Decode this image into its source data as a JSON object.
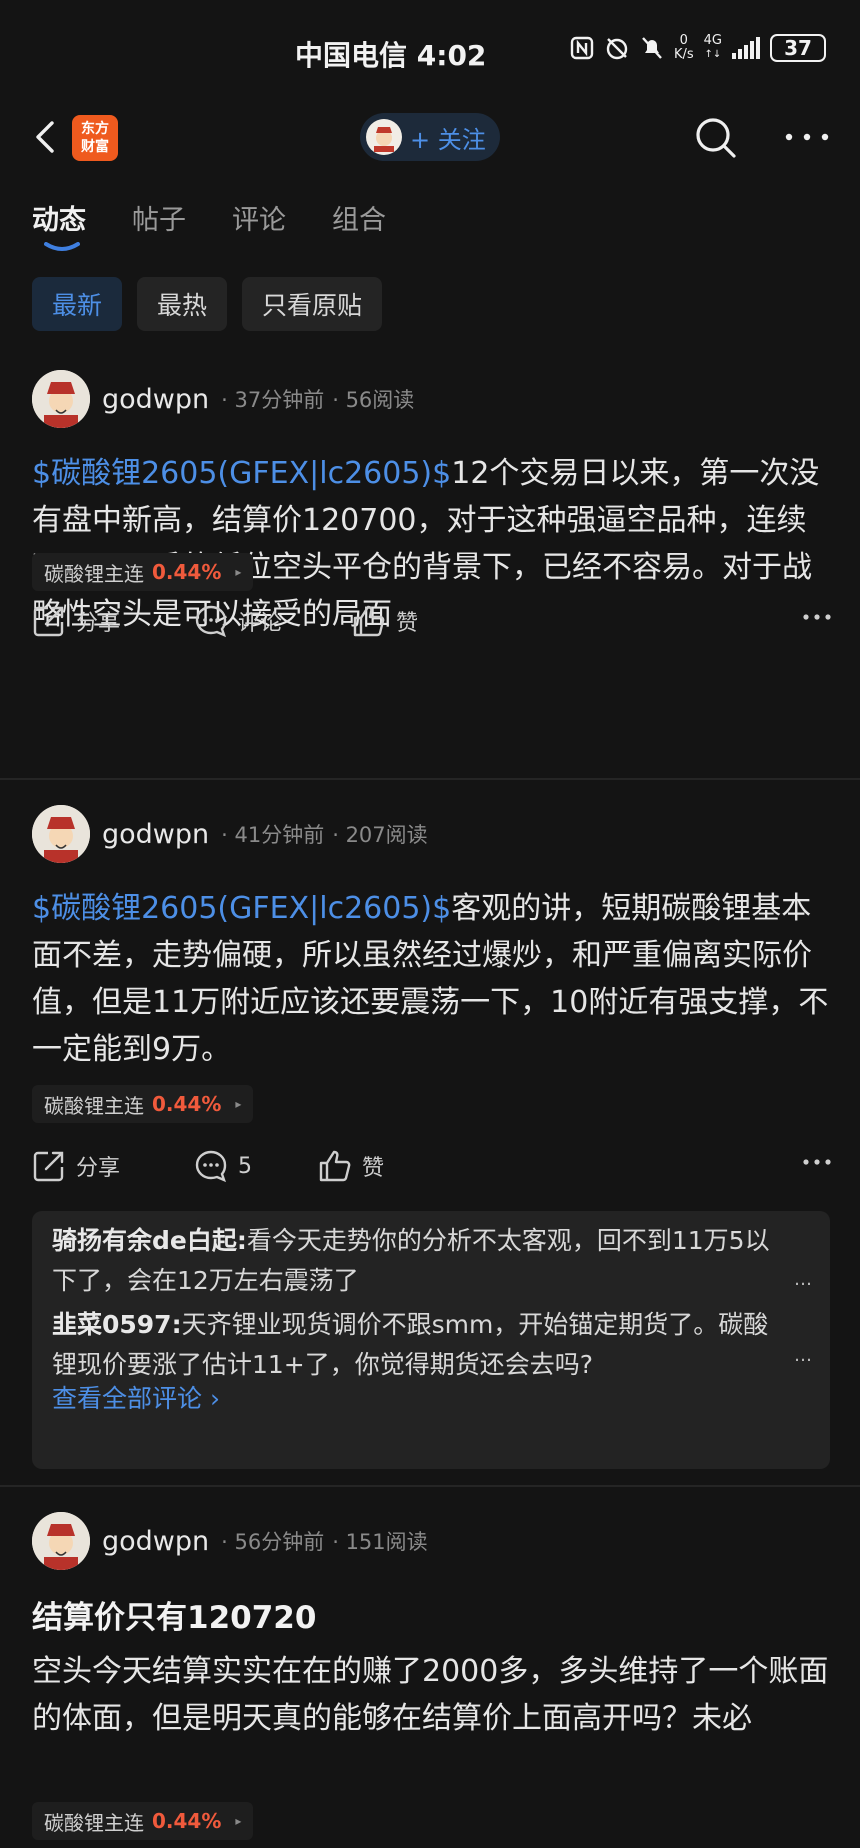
{
  "status_bar": {
    "carrier": "中国电信",
    "time": "4:02",
    "speed_top": "0",
    "speed_bottom": "K/s",
    "network": "4G",
    "battery": "37"
  },
  "header": {
    "logo_line1": "东方",
    "logo_line2": "财富",
    "follow_label": "+ 关注"
  },
  "tabs": [
    {
      "label": "动态",
      "active": true
    },
    {
      "label": "帖子",
      "active": false
    },
    {
      "label": "评论",
      "active": false
    },
    {
      "label": "组合",
      "active": false
    }
  ],
  "filters": [
    {
      "label": "最新",
      "active": true
    },
    {
      "label": "最热",
      "active": false
    },
    {
      "label": "只看原贴",
      "active": false
    }
  ],
  "posts": [
    {
      "user": "godwpn",
      "time": "· 37分钟前",
      "reads": "· 56阅读",
      "link": "$碳酸锂2605(GFEX|lc2605)$",
      "text": "12个交易日以来，第一次没有盘中新高，结算价120700，对于这种强逼空品种，连续两天几万手的低位空头平仓的背景下，已经不容易。对于战略性空头是可以接受的局面",
      "tag_name": "碳酸锂主连",
      "tag_pct": "0.44%",
      "share": "分享",
      "comment": "评论",
      "like": "赞"
    },
    {
      "user": "godwpn",
      "time": "· 41分钟前",
      "reads": "· 207阅读",
      "link": "$碳酸锂2605(GFEX|lc2605)$",
      "text": "客观的讲，短期碳酸锂基本面不差，走势偏硬，所以虽然经过爆炒，和严重偏离实际价值，但是11万附近应该还要震荡一下，10附近有强支撑，不一定能到9万。",
      "tag_name": "碳酸锂主连",
      "tag_pct": "0.44%",
      "share": "分享",
      "comment": "5",
      "like": "赞",
      "comments": [
        {
          "who": "骑扬有余de白起:",
          "text": "看今天走势你的分析不太客观，回不到11万5以下了，会在12万左右震荡了"
        },
        {
          "who": "韭菜0597:",
          "text": "天齐锂业现货调价不跟smm，开始锚定期货了。碳酸锂现价要涨了估计11+了，你觉得期货还会去吗?"
        }
      ],
      "see_all": "查看全部评论 ›"
    },
    {
      "user": "godwpn",
      "time": "· 56分钟前",
      "reads": "· 151阅读",
      "title": "结算价只有120720",
      "text": "空头今天结算实实在在的赚了2000多，多头维持了一个账面的体面，但是明天真的能够在结算价上面高开吗？未必",
      "tag_name": "碳酸锂主连",
      "tag_pct": "0.44%"
    }
  ]
}
